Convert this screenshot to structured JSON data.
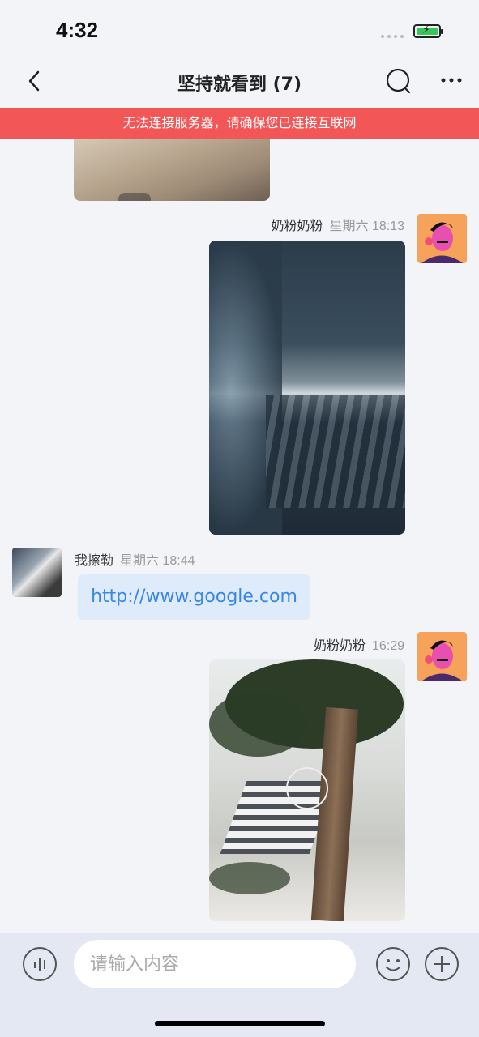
{
  "status_bar": {
    "time": "4:32"
  },
  "header": {
    "title": "坚持就看到 (7)"
  },
  "banner": {
    "text": "无法连接服务器，请确保您已连接互联网"
  },
  "messages": [
    {
      "sender": "奶粉奶粉",
      "time": "星期六 18:13",
      "type": "image",
      "side": "right"
    },
    {
      "sender": "我擦勒",
      "time": "星期六 18:44",
      "type": "link",
      "side": "left",
      "text": "http://www.google.com"
    },
    {
      "sender": "奶粉奶粉",
      "time": "16:29",
      "type": "video",
      "side": "right"
    }
  ],
  "composer": {
    "placeholder": "请输入内容"
  },
  "colors": {
    "banner": "#f25656",
    "link": "#3a86e0",
    "link_bubble": "#ddebfb"
  }
}
